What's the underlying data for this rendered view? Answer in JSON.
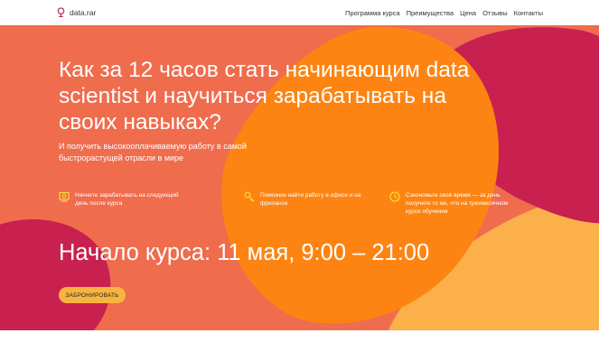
{
  "nav": {
    "logo_text": "data.rar",
    "menu": [
      {
        "label": "Программа курса"
      },
      {
        "label": "Преимущества"
      },
      {
        "label": "Цена"
      },
      {
        "label": "Отзывы"
      },
      {
        "label": "Контакты"
      }
    ]
  },
  "hero": {
    "title": "Как за 12 часов стать начинающим data scientist и научиться зарабатывать на своих навыках?",
    "subtitle": "И получить высокооплачиваемую работу в самой быстрорастущей отрасли в мире",
    "features": [
      {
        "icon": "money-icon",
        "text": "Начните зарабатывать на следующий день после курса"
      },
      {
        "icon": "key-icon",
        "text": "Поможем найти работу в офисе и на фрилансе"
      },
      {
        "icon": "clock-icon",
        "text": "Сэкономьте своё время — за день получите то же, что на трехмесячном курсе обучения"
      }
    ],
    "date": "Начало курса: 11 мая, 9:00 – 21:00",
    "cta_label": "ЗАБРОНИРОВАТЬ"
  },
  "colors": {
    "background": "#ef6c4d",
    "orange_blob": "#fd8412",
    "crimson_blob": "#c8204f",
    "yellow_blob": "#fbb04a",
    "icon": "#fce33c",
    "button": "#f9b43f",
    "logo": "#c8204f"
  }
}
